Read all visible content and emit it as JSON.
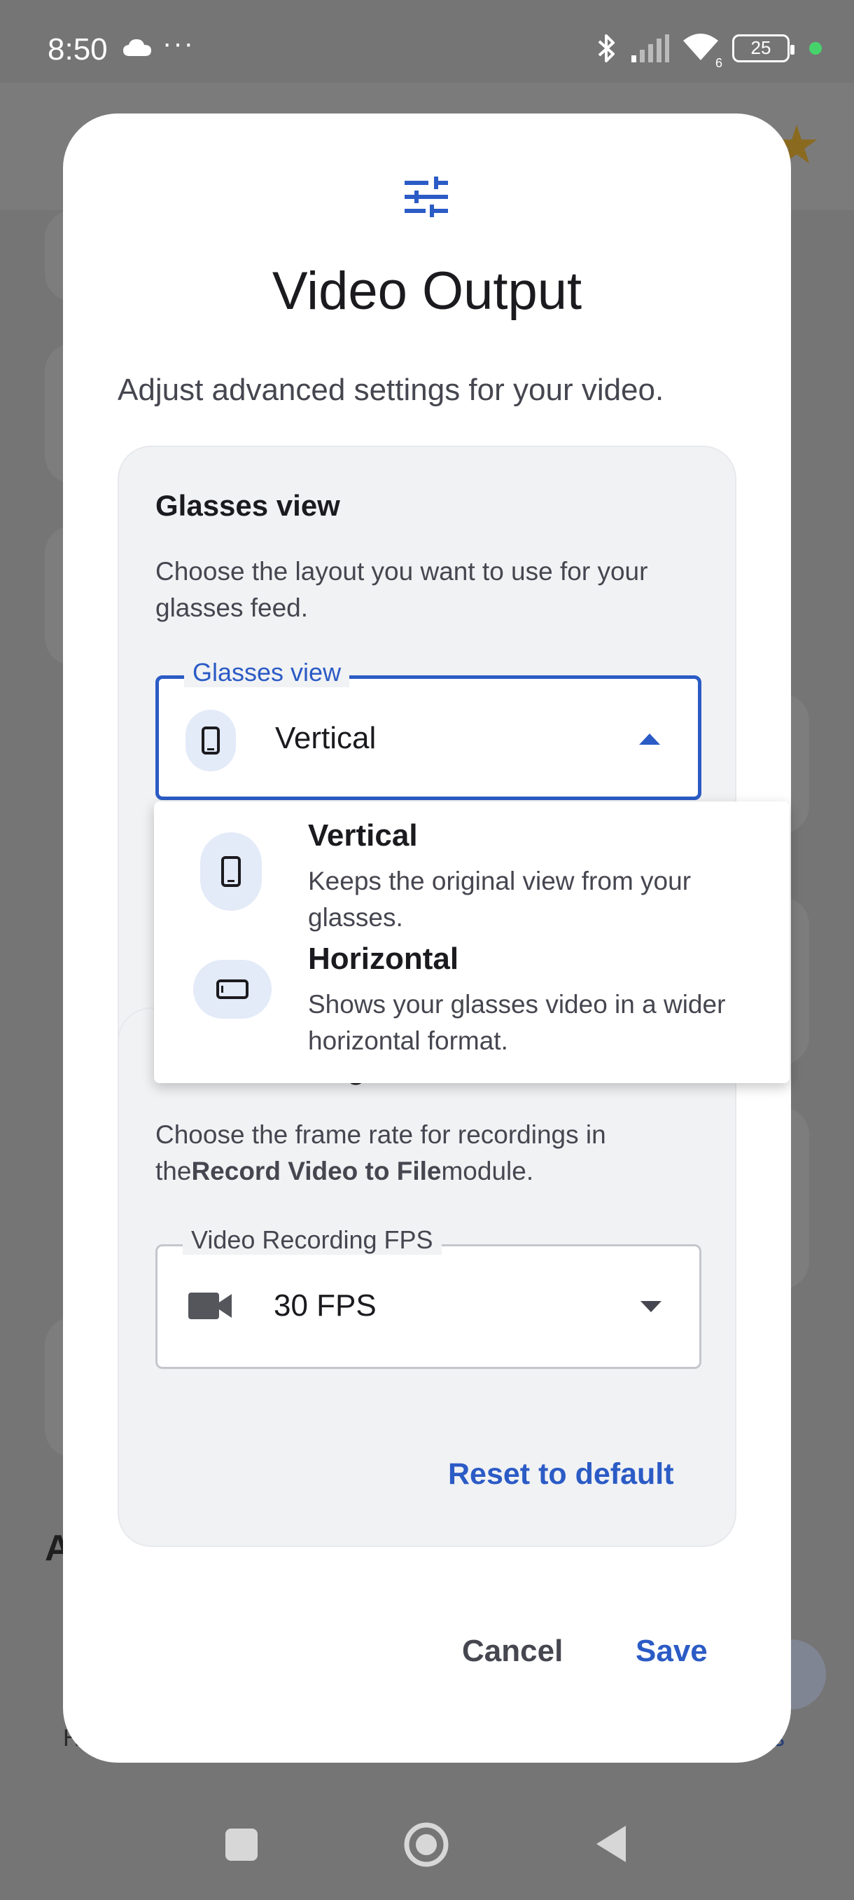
{
  "status_bar": {
    "time": "8:50",
    "more": "···",
    "battery": "25",
    "wifi_badge": "6",
    "icons": [
      "cloud-icon",
      "bluetooth-icon",
      "signal-icon",
      "wifi-icon",
      "battery-icon"
    ]
  },
  "background": {
    "letter": "A",
    "left_label": "H",
    "right_label": "ngs"
  },
  "dialog": {
    "icon": "tune-sliders-icon",
    "title": "Video Output",
    "subtitle": "Adjust advanced settings for your video.",
    "glasses_section": {
      "heading": "Glasses view",
      "description": "Choose the layout you want to use for your glasses feed.",
      "field_label": "Glasses view",
      "selected_value": "Vertical",
      "selected_icon": "phone-portrait-icon"
    },
    "fps_section": {
      "heading_partial": "g",
      "description_prefix": "Choose the frame rate for recordings in the",
      "description_bold": "Record Video to File",
      "description_suffix": "module.",
      "field_label": "Video Recording FPS",
      "selected_value": "30 FPS",
      "selected_icon": "videocam-icon",
      "reset_label": "Reset to default"
    },
    "actions": {
      "cancel": "Cancel",
      "save": "Save"
    }
  },
  "dropdown": {
    "options": [
      {
        "title": "Vertical",
        "description": "Keeps the original view from your glasses.",
        "icon": "phone-portrait-icon"
      },
      {
        "title": "Horizontal",
        "description": "Shows your glasses video in a wider horizontal format.",
        "icon": "phone-landscape-icon"
      }
    ]
  },
  "colors": {
    "accent": "#2b5bc5",
    "dialog_bg": "#ffffff",
    "card_bg": "#f1f2f4",
    "scrim": "#6b6b6b",
    "icon_chip": "#e3eaf8"
  }
}
